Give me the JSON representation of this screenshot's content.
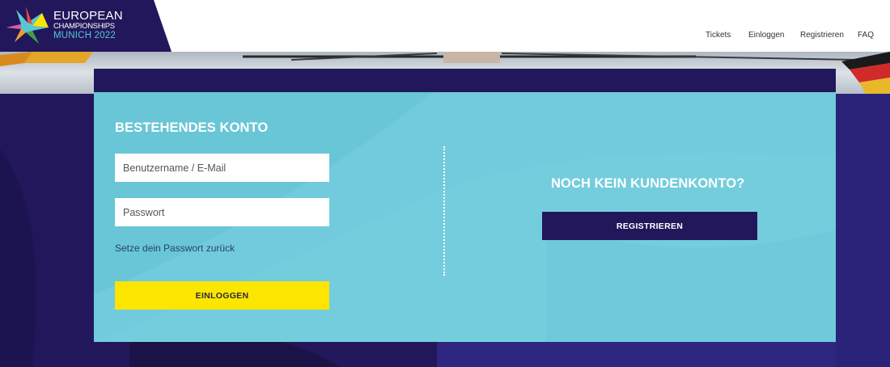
{
  "header": {
    "logo": {
      "line1": "EUROPEAN",
      "line2": "CHAMPIONSHIPS",
      "line3": "MUNICH 2022"
    },
    "nav": {
      "tickets": "Tickets",
      "login": "Einloggen",
      "register": "Registrieren",
      "faq": "FAQ"
    }
  },
  "login": {
    "title": "BESTEHENDES KONTO",
    "username_placeholder": "Benutzername / E-Mail",
    "username_value": "",
    "password_placeholder": "Passwort",
    "password_value": "",
    "reset_link": "Setze dein Passwort zurück",
    "submit_label": "EINLOGGEN"
  },
  "register": {
    "title": "NOCH KEIN KUNDENKONTO?",
    "button_label": "REGISTRIEREN"
  },
  "colors": {
    "navy": "#22175a",
    "turquoise": "#69c6d7",
    "yellow": "#fce500"
  },
  "icons": [
    "brand-star-logo-icon"
  ]
}
